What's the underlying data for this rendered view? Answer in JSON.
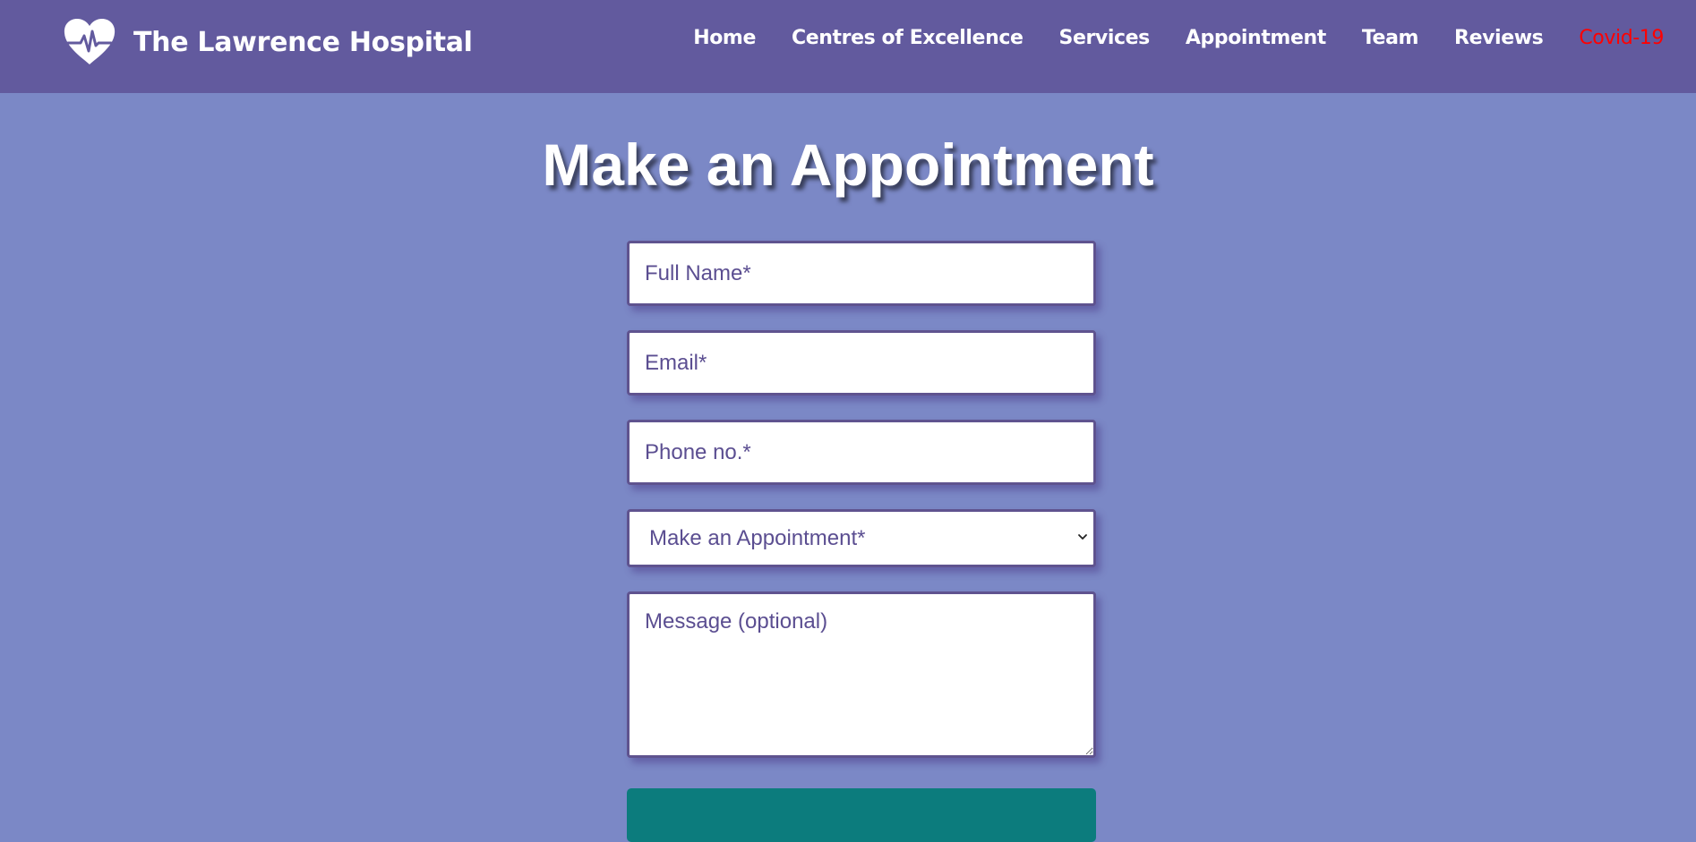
{
  "header": {
    "brand_name": "The Lawrence Hospital",
    "logo_icon": "heart-pulse-icon",
    "nav": [
      {
        "label": "Home"
      },
      {
        "label": "Centres of Excellence"
      },
      {
        "label": "Services"
      },
      {
        "label": "Appointment"
      },
      {
        "label": "Team"
      },
      {
        "label": "Reviews"
      },
      {
        "label": "Covid-19",
        "color": "#ff0000"
      }
    ]
  },
  "main": {
    "title": "Make an Appointment",
    "form": {
      "full_name_placeholder": "Full Name*",
      "email_placeholder": "Email*",
      "phone_placeholder": "Phone no.*",
      "appointment_select_value": "Make an Appointment*",
      "message_placeholder": "Message (optional)"
    }
  },
  "colors": {
    "navbar": "#625a9e",
    "background": "#7b88c6",
    "field_text": "#5b4e91",
    "field_border": "#5f538f",
    "submit_button": "#0c7c7d",
    "covid_link": "#ff0000"
  }
}
